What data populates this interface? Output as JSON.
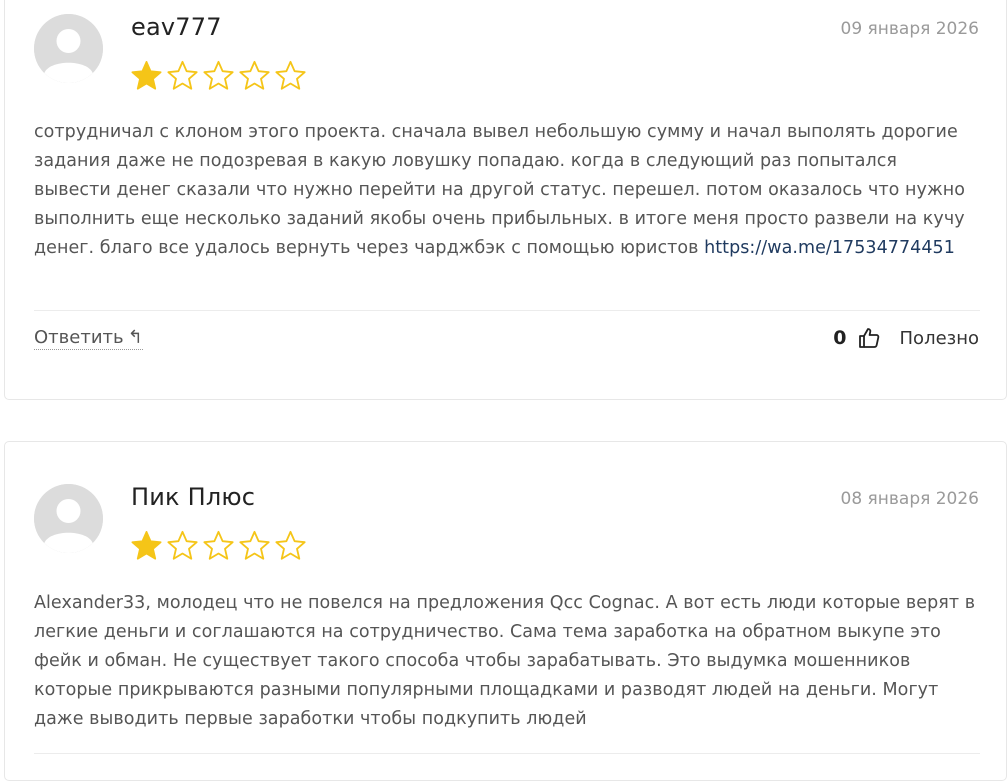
{
  "reviews": [
    {
      "author": "eav777",
      "date": "09 января 2026",
      "rating": 1,
      "max_rating": 5,
      "text": "сотрудничал с клоном этого проекта. сначала вывел небольшую сумму и начал выполять дорогие задания даже не подозревая в какую ловушку попадаю. когда в следующий раз попытался вывести денег сказали что нужно перейти на другой статус. перешел. потом оказалось что нужно выполнить еще несколько заданий якобы очень прибыльных. в итоге меня просто развели на кучу денег. благо все удалось вернуть через чарджбэк с помощью юристов ",
      "link": "https://wa.me/17534774451",
      "reply_label": "Ответить",
      "votes": "0",
      "useful_label": "Полезно"
    },
    {
      "author": "Пик Плюс",
      "date": "08 января 2026",
      "rating": 1,
      "max_rating": 5,
      "text": "Alexander33, молодец что не повелся на предложения Qcc Cognac. А вот есть люди которые верят в легкие деньги и соглашаются на сотрудничество. Сама тема заработка на обратном выкупе это фейк и обман. Не существует такого способа чтобы зарабатывать. Это выдумка мошенников которые прикрываются разными популярными площадками и разводят людей на деньги. Могут даже выводить первые заработки чтобы подкупить людей"
    }
  ],
  "colors": {
    "star_filled": "#f5c518",
    "star_outline": "#f5c518",
    "date": "#9a9a9a",
    "link": "#1f3a5f"
  },
  "icons": {
    "avatar": "user-placeholder-icon",
    "reply": "reply-arrow-icon",
    "like": "thumbs-up-icon",
    "star": "star-icon"
  }
}
